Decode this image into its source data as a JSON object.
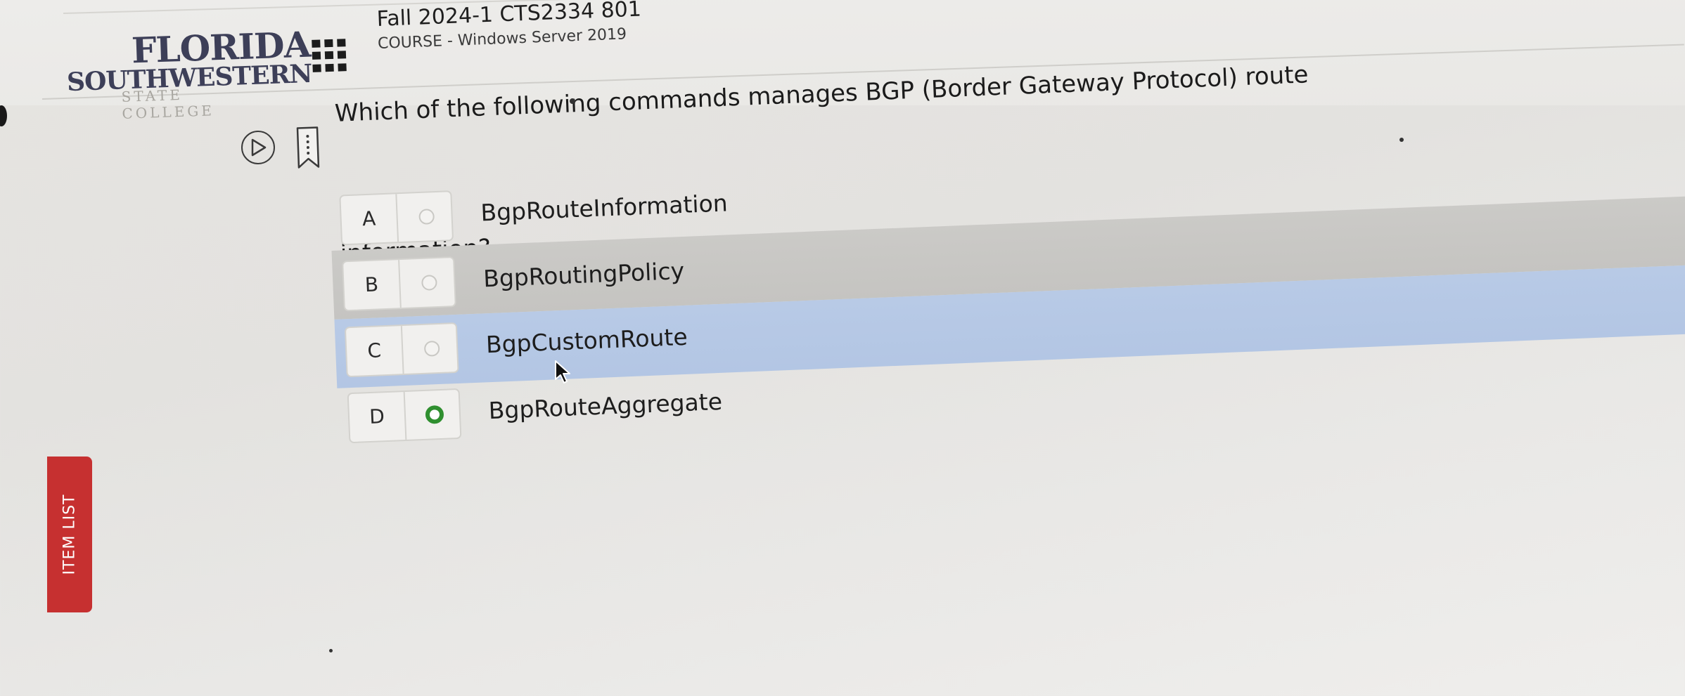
{
  "logo": {
    "line1": "FLORIDA",
    "line2": "SOUTHWESTERN",
    "line3": "STATE COLLEGE"
  },
  "course": {
    "title": "Fall 2024-1 CTS2334 801",
    "subtitle": "COURSE - Windows Server 2019"
  },
  "question": {
    "text": "Which of the following commands manages BGP (Border Gateway Protocol) route information?"
  },
  "options": [
    {
      "letter": "A",
      "text": "BgpRouteInformation",
      "selected": false
    },
    {
      "letter": "B",
      "text": "BgpRoutingPolicy",
      "selected": false
    },
    {
      "letter": "C",
      "text": "BgpCustomRoute",
      "selected": false
    },
    {
      "letter": "D",
      "text": "BgpRouteAggregate",
      "selected": true
    }
  ],
  "sidebar": {
    "item_list_label": "ITEM LIST"
  },
  "colors": {
    "selected_radio": "#2f8f2f",
    "selected_row": "#b6c8e5",
    "item_list_tab": "#c63030"
  },
  "icons": {
    "apps": "grid-icon",
    "play": "play-icon",
    "bookmark": "bookmark-icon"
  }
}
